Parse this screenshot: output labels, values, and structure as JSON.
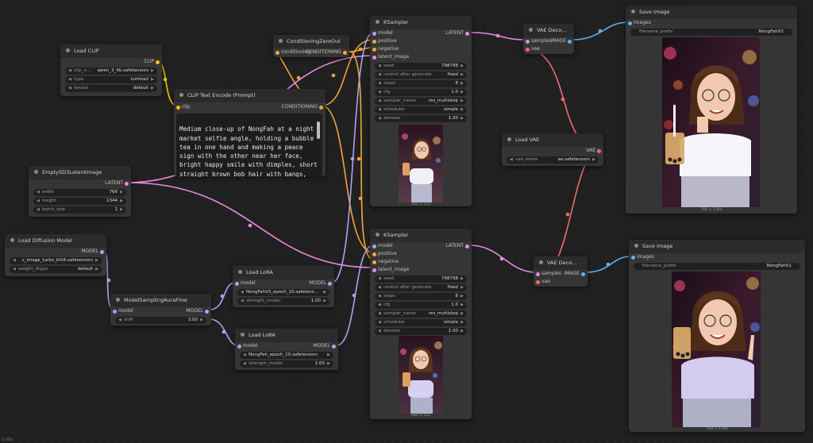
{
  "colors": {
    "clip": "#f2c200",
    "conditioning": "#f0a53a",
    "latent": "#e889e0",
    "model": "#b0a0f0",
    "vae": "#f06b6b",
    "image": "#60b0f0",
    "neutral": "#9a9a9a"
  },
  "nodes": {
    "load_clip": {
      "title": "Load CLIP",
      "output": "CLIP",
      "widgets": [
        {
          "name": "clip_n...",
          "value": "qwen_3_4b.safetensors"
        },
        {
          "name": "type",
          "value": "lumina2"
        },
        {
          "name": "device",
          "value": "default"
        }
      ]
    },
    "clip_text_encode": {
      "title": "CLIP Text Encode (Prompt)",
      "input": "clip",
      "output": "CONDITIONING",
      "text": "Medium close-up of NongFah at a night market selfie angle, holding a bubble tea in one hand and making a peace sign with the other near her face, bright happy smile with dimples, short straight brown bob hair with bangs, round clear glasses"
    },
    "conditioning_zero_out": {
      "title": "ConditioningZeroOut",
      "input": "conditioning",
      "output": "CONDITIONING"
    },
    "empty_latent": {
      "title": "EmptySD3LatentImage",
      "output": "LATENT",
      "widgets": [
        {
          "name": "width",
          "value": "768"
        },
        {
          "name": "height",
          "value": "1344"
        },
        {
          "name": "batch_size",
          "value": "1"
        }
      ]
    },
    "load_diffusion": {
      "title": "Load Diffusion Model",
      "output": "MODEL",
      "widgets": [
        {
          "name": "",
          "value": "z_image_turbo_bf16.safetensors"
        },
        {
          "name": "weight_dtype",
          "value": "default"
        }
      ]
    },
    "model_sampling": {
      "title": "ModelSamplingAuraFlow",
      "input": "model",
      "output": "MODEL",
      "widgets": [
        {
          "name": "shift",
          "value": "3.00"
        }
      ]
    },
    "lora1": {
      "title": "Load LoRA",
      "input": "model",
      "output": "MODEL",
      "widgets": [
        {
          "name": "",
          "value": "NongFahV3_epoch_10.safetens..."
        },
        {
          "name": "strength_model",
          "value": "1.00"
        }
      ]
    },
    "lora2": {
      "title": "Load LoRA",
      "input": "model",
      "output": "MODEL",
      "widgets": [
        {
          "name": "",
          "value": "NongFah_epoch_10.safetensors"
        },
        {
          "name": "strength_model",
          "value": "1.00"
        }
      ]
    },
    "ksampler1": {
      "title": "KSampler",
      "inputs": [
        "model",
        "positive",
        "negative",
        "latent_image"
      ],
      "output": "LATENT",
      "widgets": [
        {
          "name": "seed",
          "value": "798798"
        },
        {
          "name": "control after generate",
          "value": "fixed"
        },
        {
          "name": "steps",
          "value": "8"
        },
        {
          "name": "cfg",
          "value": "1.0"
        },
        {
          "name": "sampler_name",
          "value": "res_multistep"
        },
        {
          "name": "scheduler",
          "value": "simple"
        },
        {
          "name": "denoise",
          "value": "1.00"
        }
      ],
      "caption": "280 × 512"
    },
    "ksampler2": {
      "title": "KSampler",
      "inputs": [
        "model",
        "positive",
        "negative",
        "latent_image"
      ],
      "output": "LATENT",
      "widgets": [
        {
          "name": "seed",
          "value": "798798"
        },
        {
          "name": "control after generate",
          "value": "fixed"
        },
        {
          "name": "steps",
          "value": "8"
        },
        {
          "name": "cfg",
          "value": "1.0"
        },
        {
          "name": "sampler_name",
          "value": "res_multistep"
        },
        {
          "name": "scheduler",
          "value": "simple"
        },
        {
          "name": "denoise",
          "value": "1.00"
        }
      ],
      "caption": "280 × 512"
    },
    "vae_decode1": {
      "title": "VAE Deco...",
      "inputs": [
        "samples",
        "vae"
      ],
      "output": "IMAGE"
    },
    "vae_decode2": {
      "title": "VAE Deco...",
      "inputs": [
        "samples",
        "vae"
      ],
      "output": "IMAGE"
    },
    "load_vae": {
      "title": "Load VAE",
      "output": "VAE",
      "widgets": [
        {
          "name": "vae_name",
          "value": "ae.safetensors"
        }
      ]
    },
    "save1": {
      "title": "Save Image",
      "input": "images",
      "widgets": [
        {
          "name": "filename_prefix",
          "value": "NongFahV2"
        }
      ],
      "caption": "768 × 1344"
    },
    "save2": {
      "title": "Save Image",
      "input": "images",
      "widgets": [
        {
          "name": "filename_prefix",
          "value": "NongFahV1"
        }
      ],
      "caption": "768 × 1344"
    }
  },
  "status": "0.98x"
}
